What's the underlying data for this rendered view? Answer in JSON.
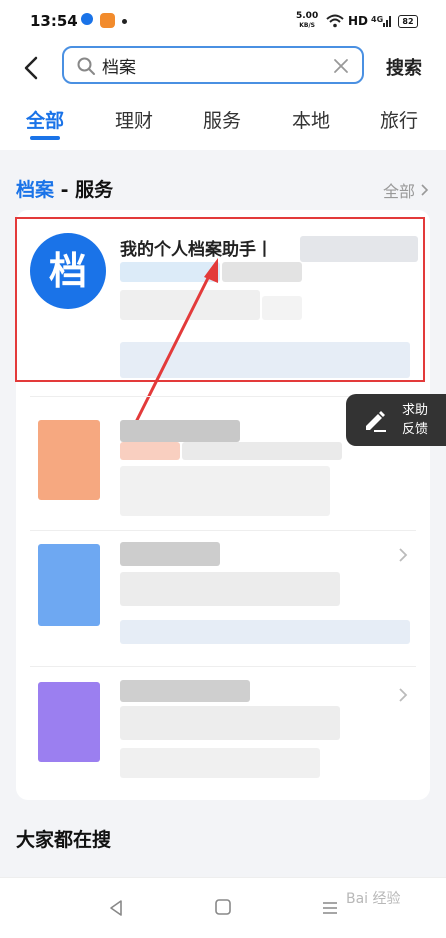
{
  "status_bar": {
    "time": "13:54",
    "network_speed_top": "5.00",
    "network_speed_bottom": "KB/S",
    "hd": "HD",
    "signal": "4G",
    "battery": "82"
  },
  "search": {
    "value": "档案",
    "button_label": "搜索"
  },
  "tabs": [
    {
      "label": "全部"
    },
    {
      "label": "理财"
    },
    {
      "label": "服务"
    },
    {
      "label": "本地"
    },
    {
      "label": "旅行"
    }
  ],
  "section": {
    "title_highlight": "档案",
    "title_rest": " - 服务",
    "more_label": "全部"
  },
  "first_item": {
    "logo_char": "档",
    "title": "我的个人档案助手丨"
  },
  "feedback": {
    "line1": "求助",
    "line2": "反馈"
  },
  "others_title": "大家都在搜",
  "watermark": "Bai 经验",
  "colors": {
    "accent": "#1a73e8",
    "highlight_box": "#e33a3a",
    "arrow": "#e33a3a"
  }
}
